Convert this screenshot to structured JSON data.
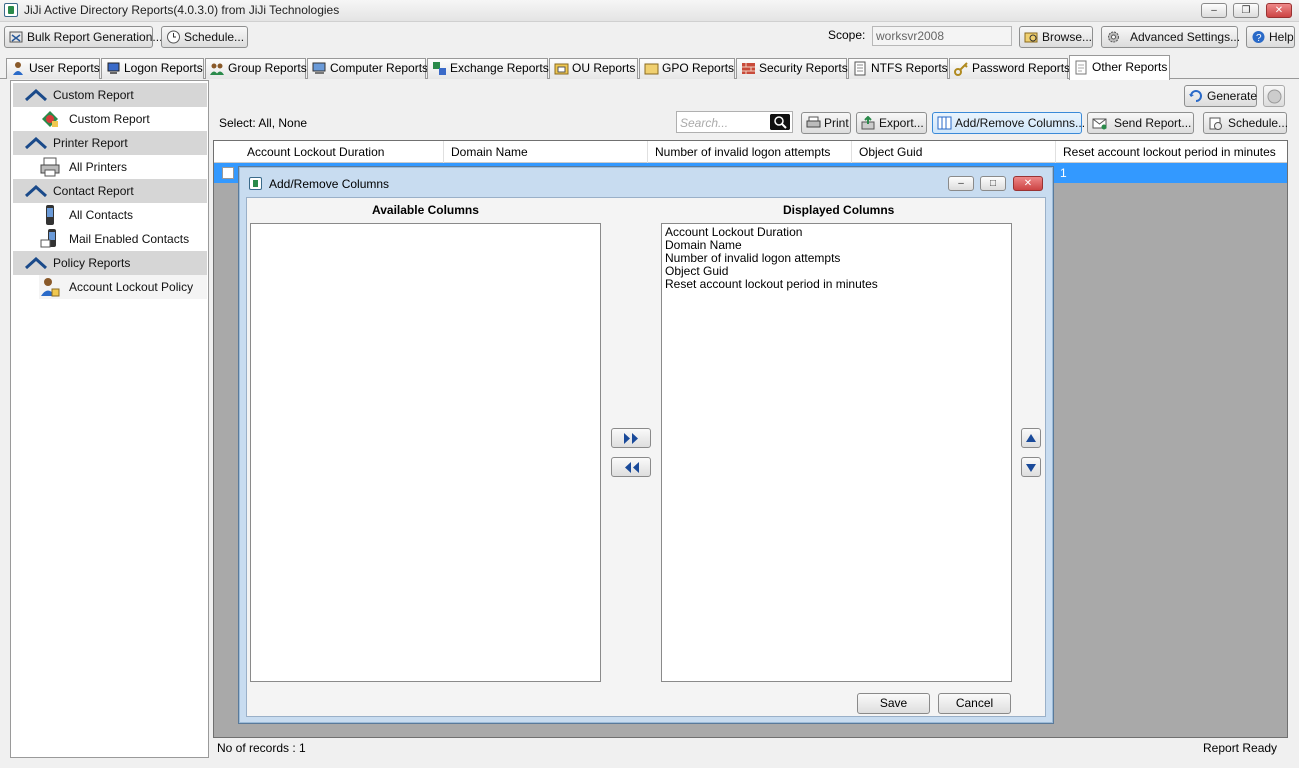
{
  "window": {
    "title": "JiJi Active Directory Reports(4.0.3.0) from JiJi Technologies",
    "min_icon": "minimize-icon",
    "max_icon": "restore-icon",
    "close_icon": "close-icon"
  },
  "toolbar": {
    "bulk_label": "Bulk Report Generation...",
    "schedule_label": "Schedule...",
    "scope_label": "Scope:",
    "scope_value": "worksvr2008",
    "browse_label": "Browse...",
    "advanced_label": "Advanced Settings...",
    "help_label": "Help"
  },
  "tabs": [
    {
      "label": "User Reports"
    },
    {
      "label": "Logon Reports"
    },
    {
      "label": "Group Reports"
    },
    {
      "label": "Computer Reports"
    },
    {
      "label": "Exchange Reports"
    },
    {
      "label": "OU Reports"
    },
    {
      "label": "GPO Reports"
    },
    {
      "label": "Security Reports"
    },
    {
      "label": "NTFS Reports"
    },
    {
      "label": "Password Reports"
    },
    {
      "label": "Other Reports",
      "active": true
    }
  ],
  "sidebar": {
    "groups": [
      {
        "label": "Custom Report",
        "items": [
          {
            "label": "Custom Report"
          }
        ]
      },
      {
        "label": "Printer Report",
        "items": [
          {
            "label": "All Printers"
          }
        ]
      },
      {
        "label": "Contact Report",
        "items": [
          {
            "label": "All Contacts"
          },
          {
            "label": "Mail Enabled Contacts"
          }
        ]
      },
      {
        "label": "Policy Reports",
        "items": [
          {
            "label": "Account Lockout Policy",
            "selected": true
          }
        ]
      }
    ]
  },
  "main": {
    "generate_label": "Generate",
    "select_text": "Select:  All,  None",
    "search_placeholder": "Search...",
    "print_label": "Print",
    "export_label": "Export...",
    "add_remove_label": "Add/Remove Columns...",
    "send_label": "Send Report...",
    "schedule_label": "Schedule...",
    "columns": [
      "Account Lockout Duration",
      "Domain Name",
      "Number of invalid logon attempts",
      "Object Guid",
      "Reset account lockout period in minutes"
    ],
    "row_value_last": "1",
    "records": "No of records : 1",
    "status": "Report Ready"
  },
  "dialog": {
    "title": "Add/Remove Columns",
    "available_title": "Available Columns",
    "displayed_title": "Displayed Columns",
    "available": [],
    "displayed": [
      "Account Lockout Duration",
      "Domain Name",
      "Number of invalid logon attempts",
      "Object Guid",
      "Reset account lockout period in minutes"
    ],
    "save_label": "Save",
    "cancel_label": "Cancel"
  },
  "colors": {
    "selection": "#3399ff",
    "grid_bg": "#a9a9a9",
    "dialog_frame": "#c8dcf0"
  }
}
